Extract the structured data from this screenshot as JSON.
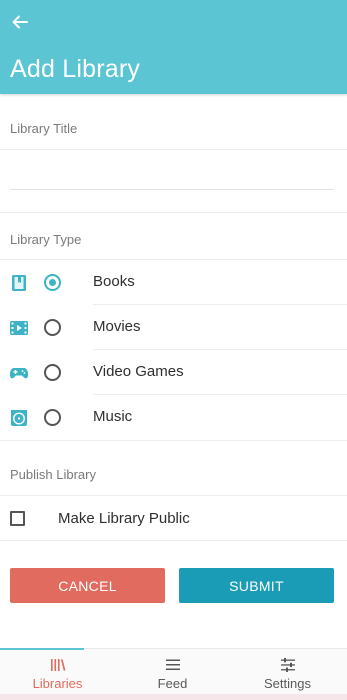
{
  "app_bar": {
    "back_icon": "arrow-left-icon",
    "title": "Add Library"
  },
  "form": {
    "title_section_label": "Library Title",
    "title_input_value": "",
    "title_input_placeholder": "",
    "type_section_label": "Library Type",
    "types": [
      {
        "label": "Books",
        "icon": "book-icon",
        "selected": true
      },
      {
        "label": "Movies",
        "icon": "film-icon",
        "selected": false
      },
      {
        "label": "Video Games",
        "icon": "gamepad-icon",
        "selected": false
      },
      {
        "label": "Music",
        "icon": "music-disc-icon",
        "selected": false
      }
    ],
    "publish_section_label": "Publish Library",
    "publish_checkbox_label": "Make Library Public",
    "publish_checked": false
  },
  "actions": {
    "cancel_label": "CANCEL",
    "submit_label": "SUBMIT"
  },
  "bottom_nav": {
    "items": [
      {
        "label": "Libraries",
        "icon": "libraries-icon",
        "active": true
      },
      {
        "label": "Feed",
        "icon": "feed-icon",
        "active": false
      },
      {
        "label": "Settings",
        "icon": "settings-sliders-icon",
        "active": false
      }
    ]
  },
  "colors": {
    "app_bar": "#5bc5d3",
    "accent": "#3fb3c6",
    "cancel": "#e06b5e",
    "submit": "#1a9bb6",
    "active_nav_label": "#e06b5e"
  }
}
